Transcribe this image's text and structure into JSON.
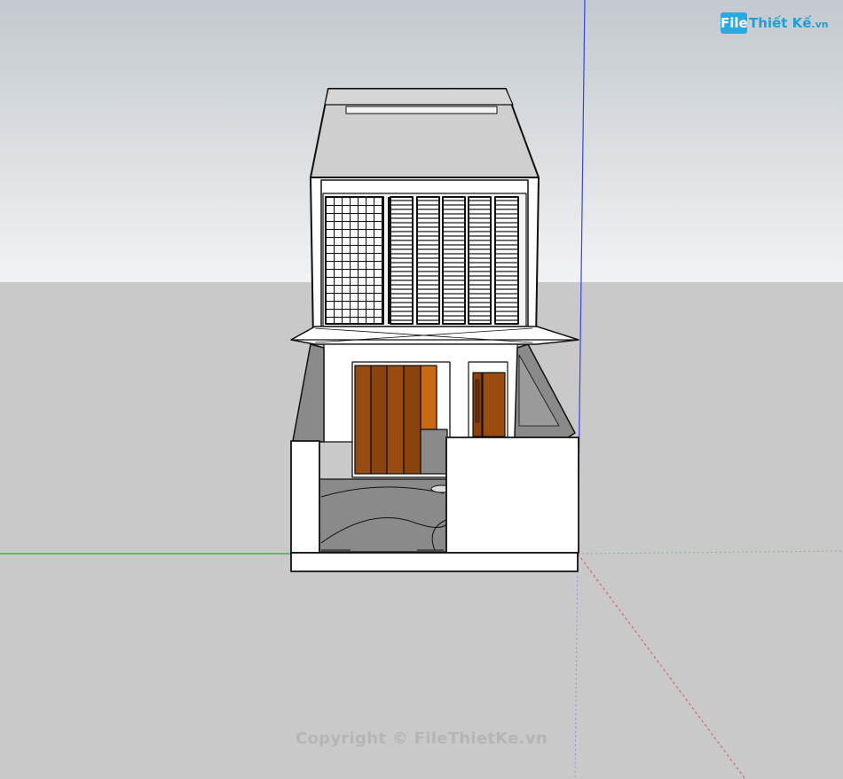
{
  "logo": {
    "box_text": "File",
    "text": "Thiết Kế",
    "ext": ".vn"
  },
  "watermark": {
    "text": "Copyright © FileThietKe.vn"
  },
  "colors": {
    "sky_top": "#c3c9ce",
    "sky_bottom": "#f1f2f3",
    "ground": "#c9c9c9",
    "wall": "#ffffff",
    "roof": "#cfcfcf",
    "door": "#9a4c0f",
    "door_light": "#c86a12",
    "axis_green": "#2ea83a",
    "axis_blue": "#3344ee",
    "axis_red": "#d86666",
    "logo_blue": "#1e9fd8"
  }
}
